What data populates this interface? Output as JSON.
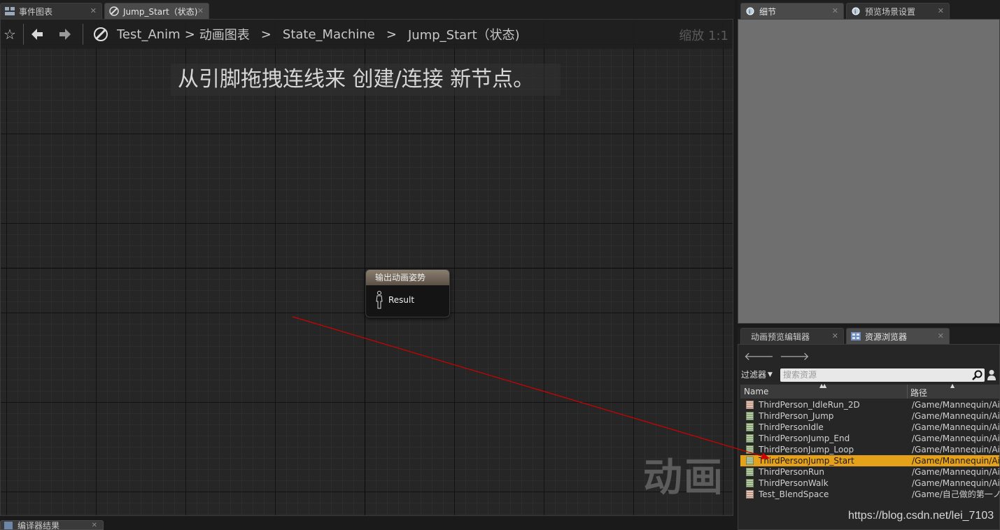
{
  "editor_tabs": [
    {
      "label": "事件图表",
      "icon": "event-graph-icon"
    },
    {
      "label": "Jump_Start（状态)",
      "icon": "state-icon"
    }
  ],
  "breadcrumb": {
    "items": [
      "Test_Anim",
      "动画图表",
      "State_Machine",
      "Jump_Start（状态)"
    ],
    "separator": ">"
  },
  "zoom": "缩放 1:1",
  "hint": "从引脚拖拽连线来 创建/连接 新节点。",
  "node": {
    "title": "输出动画姿势",
    "pin": "Result"
  },
  "watermark": "动画",
  "bottom_tab": {
    "label": "编译器结果"
  },
  "right_tabs_top": [
    {
      "label": "细节"
    },
    {
      "label": "预览场景设置"
    }
  ],
  "right_tabs_bottom": [
    {
      "label": "动画预览编辑器"
    },
    {
      "label": "资源浏览器"
    }
  ],
  "content_browser": {
    "filter_label": "过滤器",
    "search_placeholder": "搜索资源",
    "columns": {
      "name": "Name",
      "path": "路径"
    },
    "rows": [
      {
        "name": "ThirdPerson_IdleRun_2D",
        "path": "/Game/Mannequin/Ai",
        "kind": "blendspace"
      },
      {
        "name": "ThirdPerson_Jump",
        "path": "/Game/Mannequin/Ai",
        "kind": "anim"
      },
      {
        "name": "ThirdPersonIdle",
        "path": "/Game/Mannequin/Ai",
        "kind": "anim"
      },
      {
        "name": "ThirdPersonJump_End",
        "path": "/Game/Mannequin/Ai",
        "kind": "anim"
      },
      {
        "name": "ThirdPersonJump_Loop",
        "path": "/Game/Mannequin/Ai",
        "kind": "anim"
      },
      {
        "name": "ThirdPersonJump_Start",
        "path": "/Game/Mannequin/Ai",
        "kind": "anim",
        "selected": true
      },
      {
        "name": "ThirdPersonRun",
        "path": "/Game/Mannequin/Ai",
        "kind": "anim"
      },
      {
        "name": "ThirdPersonWalk",
        "path": "/Game/Mannequin/Ai",
        "kind": "anim"
      },
      {
        "name": "Test_BlendSpace",
        "path": "/Game/自己做的第一ノ",
        "kind": "blendspace"
      }
    ]
  },
  "colors": {
    "selection": "#e6a11a",
    "arrow": "#cc0000"
  },
  "credit": "https://blog.csdn.net/lei_7103"
}
